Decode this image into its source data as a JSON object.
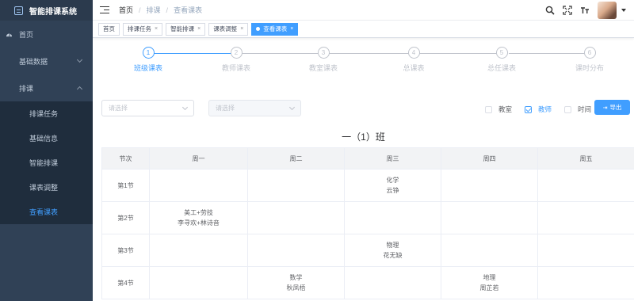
{
  "app": {
    "title": "智能排课系统"
  },
  "sidebar": {
    "items": [
      {
        "label": "首页"
      },
      {
        "label": "基础数据"
      },
      {
        "label": "排课"
      }
    ],
    "submenu": [
      {
        "label": "排课任务"
      },
      {
        "label": "基础信息"
      },
      {
        "label": "智能排课"
      },
      {
        "label": "课表调整"
      },
      {
        "label": "查看课表"
      }
    ]
  },
  "navbar": {
    "breadcrumb": [
      "首页",
      "排课",
      "查看课表"
    ],
    "icons": [
      "search-icon",
      "fullscreen-icon",
      "font-size-icon",
      "avatar"
    ]
  },
  "tags": [
    {
      "label": "首页"
    },
    {
      "label": "排课任务"
    },
    {
      "label": "智能排课"
    },
    {
      "label": "课表调整"
    },
    {
      "label": "查看课表"
    }
  ],
  "steps": [
    {
      "num": "1",
      "title": "班级课表"
    },
    {
      "num": "2",
      "title": "教师课表"
    },
    {
      "num": "3",
      "title": "教室课表"
    },
    {
      "num": "4",
      "title": "总课表"
    },
    {
      "num": "5",
      "title": "总任课表"
    },
    {
      "num": "6",
      "title": "课时分布"
    }
  ],
  "filters": {
    "select1_placeholder": "请选择",
    "select2_placeholder": "请选择",
    "checkboxes": [
      {
        "label": "教室",
        "checked": false
      },
      {
        "label": "教师",
        "checked": true
      },
      {
        "label": "时间",
        "checked": false
      }
    ],
    "export_label": "导出"
  },
  "class_title": "一（1）班",
  "timetable": {
    "headers": [
      "节次",
      "周一",
      "周二",
      "周三",
      "周四",
      "周五"
    ],
    "rows": [
      {
        "period": "第1节",
        "cells": [
          [
            "",
            ""
          ],
          [
            "",
            ""
          ],
          [
            "化学",
            "云铮"
          ],
          [
            "",
            ""
          ],
          [
            "",
            ""
          ]
        ]
      },
      {
        "period": "第2节",
        "cells": [
          [
            "美工+劳技",
            "李寻欢+林诗音"
          ],
          [
            "",
            ""
          ],
          [
            "",
            ""
          ],
          [
            "",
            ""
          ],
          [
            "",
            ""
          ]
        ]
      },
      {
        "period": "第3节",
        "cells": [
          [
            "",
            ""
          ],
          [
            "",
            ""
          ],
          [
            "物理",
            "花无缺"
          ],
          [
            "",
            ""
          ],
          [
            "",
            ""
          ]
        ]
      },
      {
        "period": "第4节",
        "cells": [
          [
            "",
            ""
          ],
          [
            "数学",
            "秋凤梧"
          ],
          [
            "",
            ""
          ],
          [
            "地理",
            "周芷若"
          ],
          [
            "",
            ""
          ]
        ]
      }
    ]
  },
  "colors": {
    "sidebar_bg": "#304156",
    "accent": "#409eff",
    "submenu_bg": "#1f2d3d"
  }
}
